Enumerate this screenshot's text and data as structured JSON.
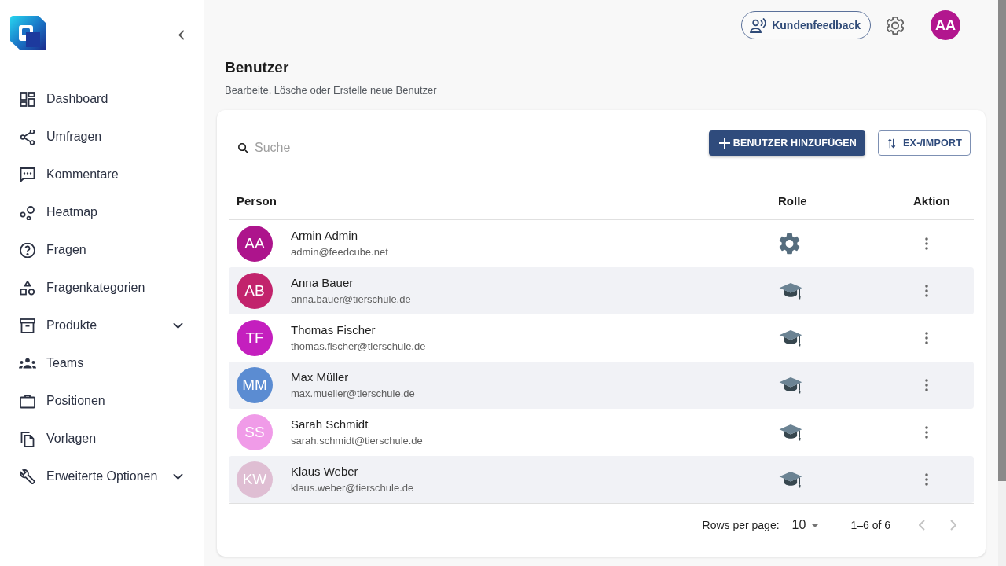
{
  "sidebar": {
    "items": [
      {
        "label": "Dashboard",
        "kind": "link"
      },
      {
        "label": "Umfragen",
        "kind": "link"
      },
      {
        "label": "Kommentare",
        "kind": "link"
      },
      {
        "label": "Heatmap",
        "kind": "link"
      },
      {
        "label": "Fragen",
        "kind": "link"
      },
      {
        "label": "Fragenkategorien",
        "kind": "link"
      },
      {
        "label": "Produkte",
        "kind": "group",
        "expanded": false
      },
      {
        "label": "Teams",
        "kind": "link"
      },
      {
        "label": "Positionen",
        "kind": "link"
      },
      {
        "label": "Vorlagen",
        "kind": "link"
      },
      {
        "label": "Erweiterte Optionen",
        "kind": "group",
        "expanded": false
      }
    ]
  },
  "topbar": {
    "feedback_button": "Kundenfeedback",
    "user_avatar": {
      "initials": "AA",
      "color": "#b2168e"
    }
  },
  "page": {
    "title": "Benutzer",
    "subtitle": "Bearbeite, Lösche oder Erstelle neue Benutzer"
  },
  "toolbar": {
    "search": {
      "placeholder": "Suche"
    },
    "buttons": [
      {
        "label": "BENUTZER HINZUFÜGEN",
        "kind": "primary"
      },
      {
        "label": "EX-/IMPORT",
        "kind": "outlined"
      }
    ]
  },
  "table": {
    "columns": [
      "Person",
      "Rolle",
      "Aktion"
    ],
    "rows": [
      {
        "initials": "AA",
        "color": "#ad148c",
        "name": "Armin Admin",
        "email": "admin@feedcube.net",
        "kind": "admin"
      },
      {
        "initials": "AB",
        "color": "#c2236c",
        "name": "Anna Bauer",
        "email": "anna.bauer@tierschule.de",
        "kind": "student"
      },
      {
        "initials": "TF",
        "color": "#c41fbe",
        "name": "Thomas Fischer",
        "email": "thomas.fischer@tierschule.de",
        "kind": "student"
      },
      {
        "initials": "MM",
        "color": "#5b8cd2",
        "name": "Max Müller",
        "email": "max.mueller@tierschule.de",
        "kind": "student"
      },
      {
        "initials": "SS",
        "color": "#f09be8",
        "name": "Sarah Schmidt",
        "email": "sarah.schmidt@tierschule.de",
        "kind": "student"
      },
      {
        "initials": "KW",
        "color": "#dfbed3",
        "name": "Klaus Weber",
        "email": "klaus.weber@tierschule.de",
        "kind": "student"
      }
    ]
  },
  "pagination": {
    "rows_per_page_label": "Rows per page:",
    "rows_per_page": "10",
    "range": "1–6 of 6",
    "previous_disabled": true,
    "next_disabled": true
  }
}
